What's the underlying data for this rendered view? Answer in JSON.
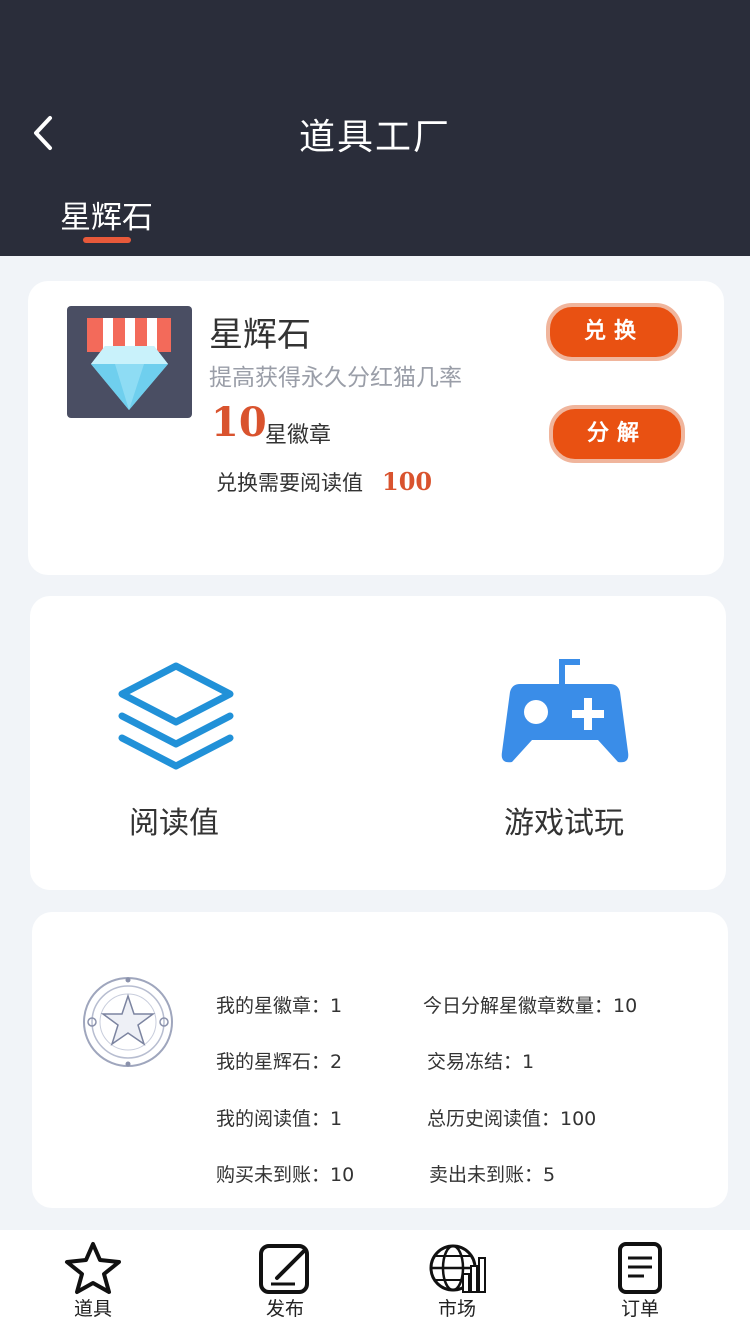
{
  "header": {
    "title": "道具工厂",
    "tab": "星辉石"
  },
  "item": {
    "name": "星辉石",
    "description": "提高获得永久分红猫几率",
    "price": "10",
    "price_unit": "星徽章",
    "requirement_label": "兑换需要阅读值",
    "requirement_value": "100",
    "exchange_button": "兑换",
    "decompose_button": "分解"
  },
  "functions": {
    "reading": "阅读值",
    "game": "游戏试玩"
  },
  "stats": {
    "my_badges": "我的星徽章：1",
    "today_decomposed": "今日分解星徽章数量：10",
    "my_stones": "我的星辉石：2",
    "trade_frozen": "交易冻结：1",
    "my_reading": "我的阅读值：1",
    "total_reading": "总历史阅读值：100",
    "buy_pending": "购买未到账：10",
    "sell_pending": "卖出未到账：5"
  },
  "tabbar": {
    "props": "道具",
    "publish": "发布",
    "market": "市场",
    "orders": "订单"
  },
  "colors": {
    "header_bg": "#2a2d3a",
    "accent": "#e95112",
    "price": "#d9532e",
    "icon_blue": "#3a8de8"
  },
  "icons": [
    "chevron-left-icon",
    "diamond-badge-icon",
    "layers-icon",
    "gamepad-icon",
    "star-emblem-icon",
    "star-icon",
    "edit-icon",
    "globe-chart-icon",
    "document-icon"
  ]
}
